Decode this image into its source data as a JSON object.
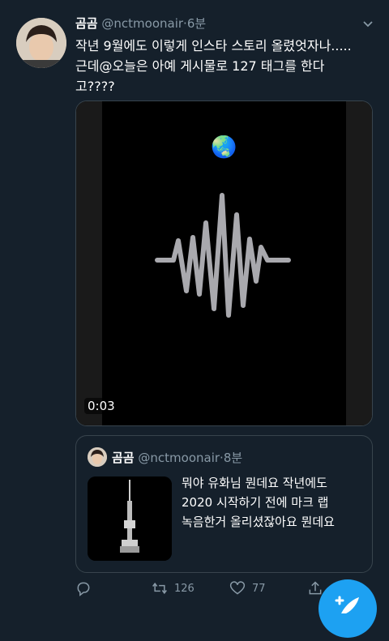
{
  "tweet": {
    "author_name": "곰곰",
    "handle": "@nctmoonair",
    "separator": "·",
    "time": "6분",
    "text": "작년 9월에도 이렇게 인스타 스토리 올렸엇자나.....\n근데@오늘은 아예 게시물로 127 태그를 한다\n고????",
    "video_duration": "0:03",
    "globe_emoji": "🌏"
  },
  "quoted": {
    "author_name": "곰곰",
    "handle": "@nctmoonair",
    "separator": "·",
    "time": "8분",
    "text": "뭐야 유화님 뭔데요 작년에도\n2020 시작하기 전에 마크 랩\n녹음한거 올리셨잖아요 뭔데요"
  },
  "actions": {
    "reply_icon": "reply-icon",
    "retweet_icon": "retweet-icon",
    "retweet_count": "126",
    "like_icon": "heart-icon",
    "like_count": "77",
    "share_icon": "share-icon"
  },
  "colors": {
    "background": "#15202b",
    "muted": "#8899a6",
    "accent": "#1da1f2",
    "border": "#38444d"
  }
}
